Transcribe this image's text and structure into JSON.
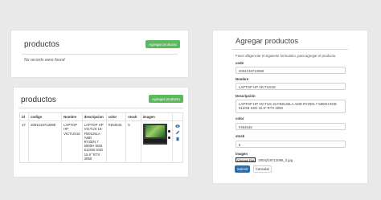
{
  "panel_empty": {
    "title": "productos",
    "add_button": "Agregar producto",
    "empty_message": "No records were found"
  },
  "panel_list": {
    "title": "productos",
    "add_button": "Agregar producto",
    "columns": [
      "id",
      "codigo",
      "Nombre",
      "descripcion",
      "color",
      "stock",
      "imagen"
    ],
    "rows": [
      {
        "id": "47",
        "codigo": "2004219713088",
        "nombre": "LAPTOP HP VICTUS15",
        "descripcion": "LAPTOP HP VICTUS 15-FB0125LA AMD RYZEN 7 5800H 8GB 512GB SSD 15.6\" RTX 3050",
        "color": "#454545",
        "stock": "5"
      }
    ]
  },
  "form": {
    "title": "Agregar productos",
    "description": "Favor diligenciar el siguiente formulario, para agregar el producto.",
    "fields": {
      "codigo": {
        "label": "code",
        "value": "2004219713088"
      },
      "nombre": {
        "label": "Nombre",
        "value": "LAPTOP HP VICTUS15"
      },
      "descripcion": {
        "label": "Descripción",
        "value": "LAPTOP HP VICTUS 15-FB0125LA AMD RYZEN 7 5800H 8GB 512GB SSD 15.6\" RTX 3050"
      },
      "color": {
        "label": "color",
        "value": "#454545"
      },
      "stock": {
        "label": "stock",
        "value": "5"
      },
      "imagen": {
        "label": "imagen",
        "button": "Choose File",
        "filename": "2004219713088_2.jpg"
      }
    },
    "submit": "Submit",
    "cancel": "Cancelar"
  },
  "colors": {
    "primary": "#2e6da4",
    "success": "#5cb85c",
    "panel_bg": "#ffffff",
    "page_bg": "#e9e9e9"
  },
  "icons": [
    "laptop-image",
    "eye-icon",
    "edit-icon",
    "delete-icon"
  ]
}
